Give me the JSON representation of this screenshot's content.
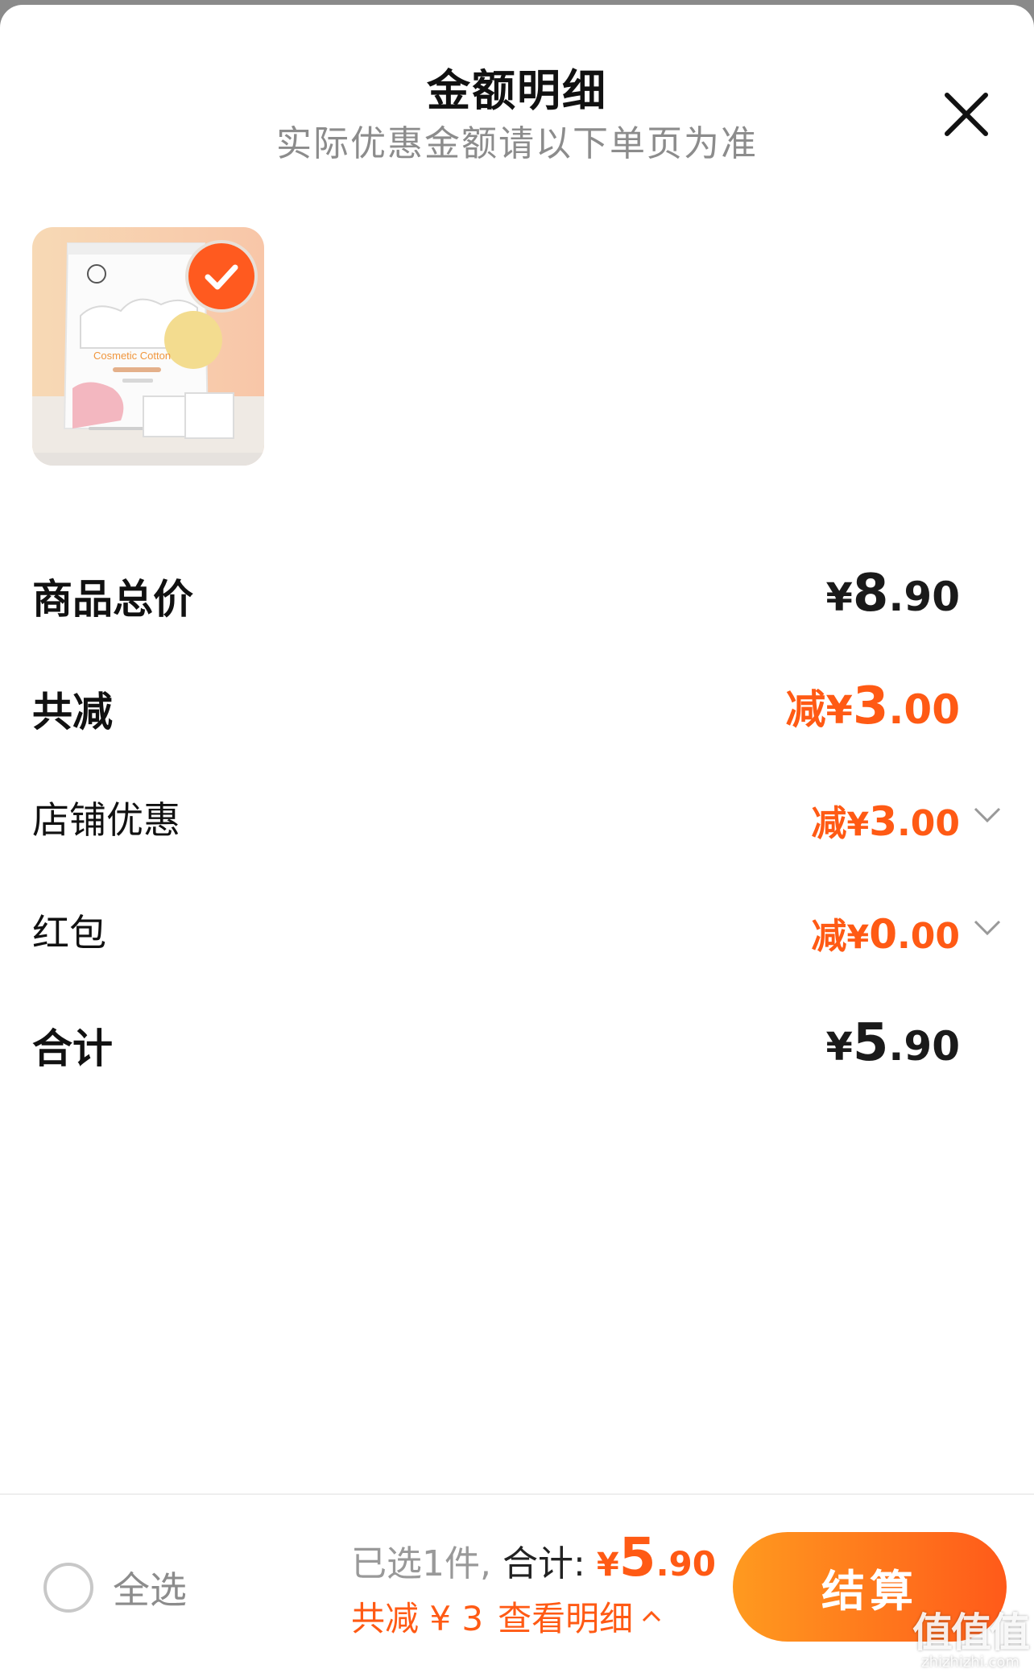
{
  "header": {
    "title": "金额明细",
    "subtitle": "实际优惠金额请以下单页为准"
  },
  "product": {
    "image_text": "Cosmetic Cotton",
    "selected": true
  },
  "breakdown": {
    "total_price": {
      "label": "商品总价",
      "yen": "¥",
      "int": "8",
      "dec": ".90"
    },
    "total_discount": {
      "label": "共减",
      "prefix": "减",
      "yen": "¥",
      "int": "3",
      "dec": ".00"
    },
    "store_discount": {
      "label": "店铺优惠",
      "prefix": "减",
      "yen": "¥",
      "int": "3",
      "dec": ".00"
    },
    "red_packet": {
      "label": "红包",
      "prefix": "减",
      "yen": "¥",
      "int": "0",
      "dec": ".00"
    },
    "sum": {
      "label": "合计",
      "yen": "¥",
      "int": "5",
      "dec": ".90"
    }
  },
  "bottom_bar": {
    "select_all_label": "全选",
    "selected_count_text": "已选1件,",
    "total_label": "合计:",
    "total_yen": "¥",
    "total_int": "5",
    "total_dec": ".90",
    "discount_text": "共减 ¥ 3",
    "view_detail_label": "查看明细",
    "checkout_label": "结算"
  },
  "watermark": {
    "main": "值值值",
    "sub": "zhizhizhi.com"
  },
  "colors": {
    "accent": "#ff5a14",
    "checkout_gradient_start": "#ff9a1f",
    "checkout_gradient_end": "#ff5a1a",
    "text_primary": "#111111",
    "text_secondary": "#8c8c8c"
  }
}
